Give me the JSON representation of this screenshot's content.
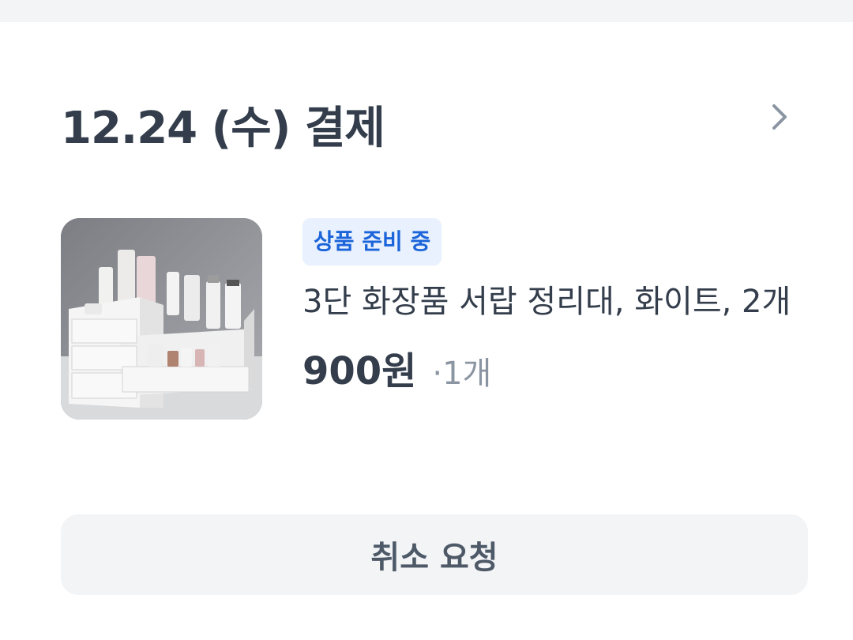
{
  "order": {
    "date_label": "12.24 (수) 결제",
    "detail_icon": "chevron-right-icon"
  },
  "product": {
    "image_icon": "cosmetic-organizer-photo",
    "status": "상품 준비 중",
    "name": "3단 화장품 서랍 정리대, 화이트, 2개",
    "price": "900원",
    "quantity": "·1개"
  },
  "actions": {
    "cancel_label": "취소 요청"
  },
  "colors": {
    "accent": "#1b64da",
    "badge_bg": "#e8f1fd",
    "text_primary": "#333d4b",
    "text_secondary": "#8b95a1",
    "button_bg": "#f2f4f6"
  }
}
